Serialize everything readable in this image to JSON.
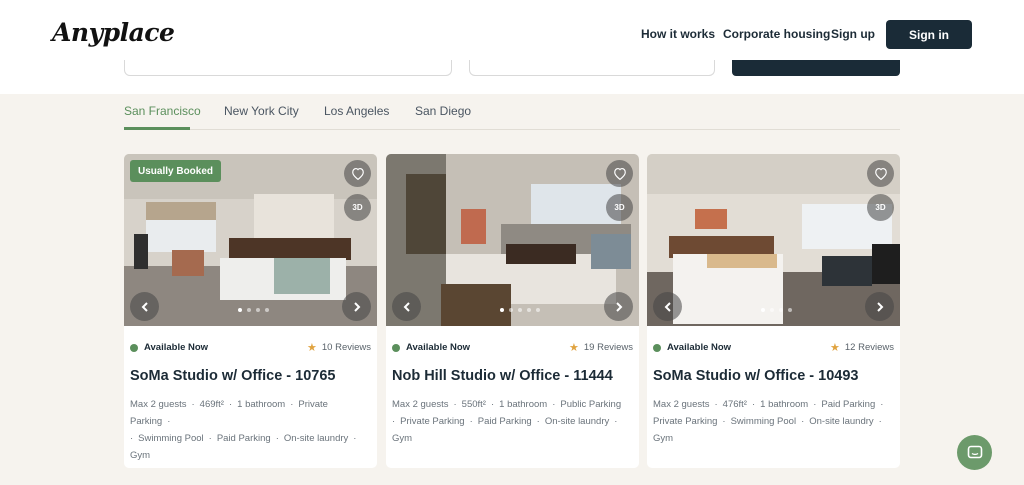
{
  "brand": {
    "logo": "Anyplace"
  },
  "nav": {
    "how_it_works": "How it works",
    "corporate_housing": "Corporate housing",
    "sign_up": "Sign up",
    "sign_in": "Sign in"
  },
  "tabs": [
    {
      "label": "San Francisco",
      "active": true
    },
    {
      "label": "New York City",
      "active": false
    },
    {
      "label": "Los Angeles",
      "active": false
    },
    {
      "label": "San Diego",
      "active": false
    }
  ],
  "listings": [
    {
      "badge": "Usually Booked",
      "availability": "Available Now",
      "reviews": "10 Reviews",
      "title": "SoMa Studio w/ Office - 10765",
      "amenities": [
        "Max 2 guests",
        "469ft²",
        "1 bathroom",
        "Private Parking",
        "Swimming Pool",
        "Paid Parking",
        "On-site laundry",
        "Gym"
      ],
      "tour_icon_label": "3D"
    },
    {
      "badge": "",
      "availability": "Available Now",
      "reviews": "19 Reviews",
      "title": "Nob Hill Studio w/ Office - 11444",
      "amenities": [
        "Max 2 guests",
        "550ft²",
        "1 bathroom",
        "Public Parking",
        "Private Parking",
        "Paid Parking",
        "On-site laundry",
        "Gym"
      ],
      "tour_icon_label": "3D"
    },
    {
      "badge": "",
      "availability": "Available Now",
      "reviews": "12 Reviews",
      "title": "SoMa Studio w/ Office - 10493",
      "amenities": [
        "Max 2 guests",
        "476ft²",
        "1 bathroom",
        "Paid Parking",
        "Private Parking",
        "Swimming Pool",
        "On-site laundry",
        "Gym"
      ],
      "tour_icon_label": "3D"
    }
  ],
  "icons": [
    "heart-icon",
    "3d-tour-icon",
    "chevron-left-icon",
    "chevron-right-icon",
    "star-icon",
    "chat-icon"
  ],
  "colors": {
    "brand_green": "#5b8f5c",
    "navy": "#1a2b37",
    "star": "#e0a340"
  }
}
